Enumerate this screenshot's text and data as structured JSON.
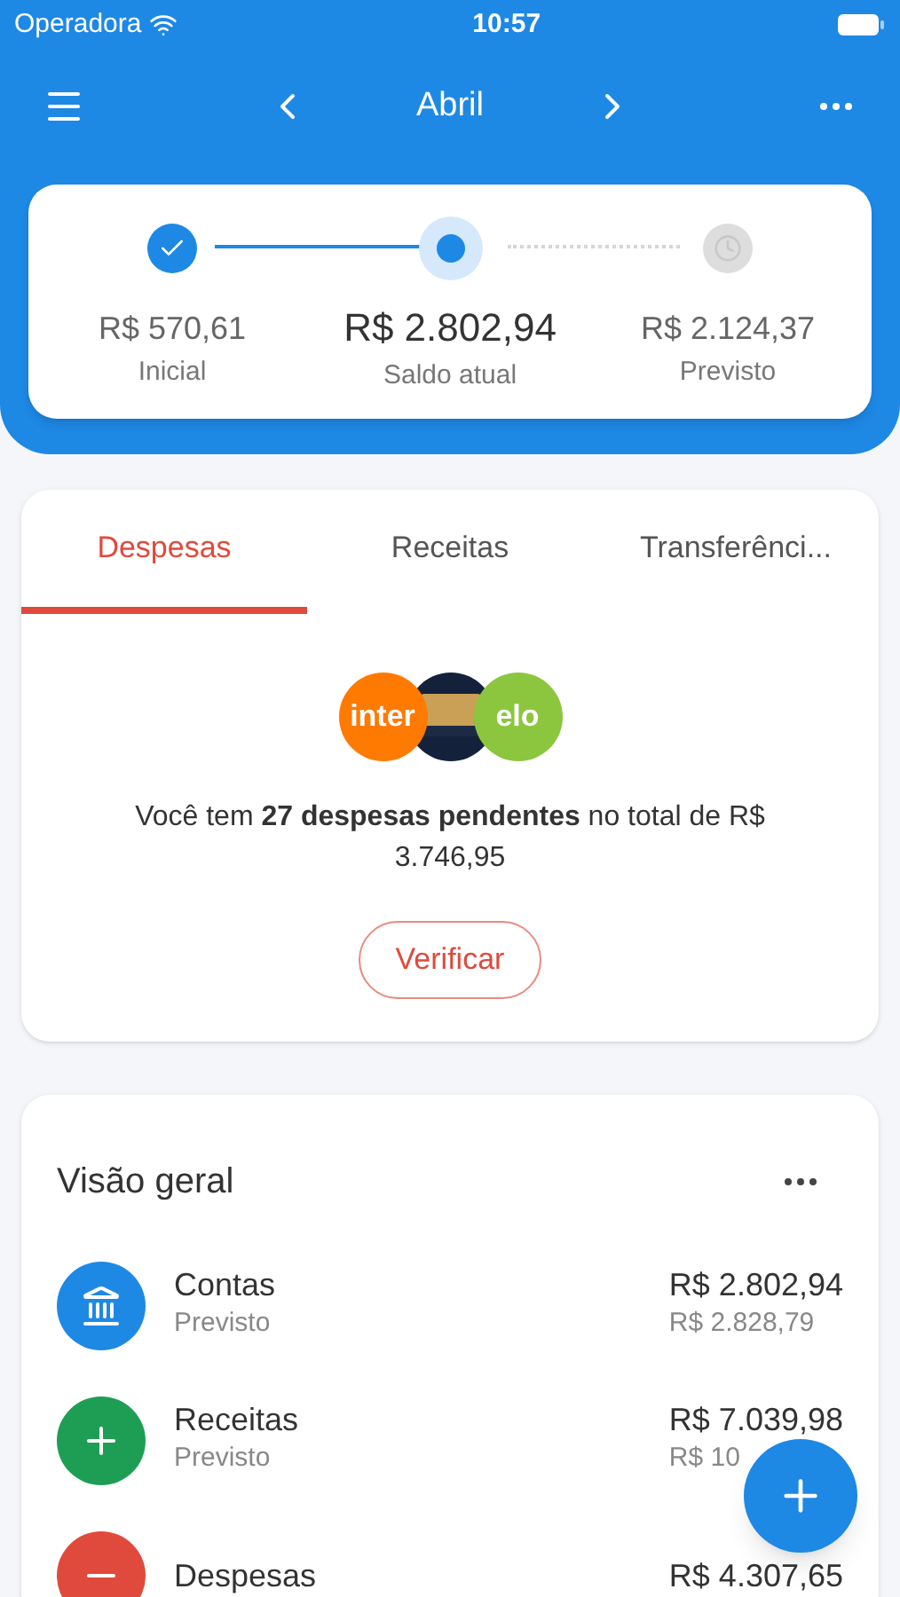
{
  "status_bar": {
    "carrier": "Operadora",
    "time": "10:57"
  },
  "nav": {
    "month": "Abril"
  },
  "balance_steps": [
    {
      "kind": "done",
      "amount": "R$ 570,61",
      "label": "Inicial"
    },
    {
      "kind": "current",
      "amount": "R$ 2.802,94",
      "label": "Saldo atual"
    },
    {
      "kind": "pending",
      "amount": "R$ 2.124,37",
      "label": "Previsto"
    }
  ],
  "tabs": [
    {
      "label": "Despesas",
      "selected": true
    },
    {
      "label": "Receitas",
      "selected": false
    },
    {
      "label": "Transferênci...",
      "selected": false
    }
  ],
  "logos": [
    {
      "kind": "text",
      "label": "inter",
      "color": "#ff7a00"
    },
    {
      "kind": "picture"
    },
    {
      "kind": "text",
      "label": "elo",
      "color": "#8cc63f"
    }
  ],
  "pending_message": "Você tem **27 despesas pendentes** no total de R$ 3.746,95",
  "verify_button": "Verificar",
  "overview": {
    "title": "Visão geral",
    "rows": [
      {
        "kind": "bank",
        "name": "Contas",
        "sub": "Previsto",
        "amount": "R$ 2.802,94",
        "forecast": "R$ 2.828,79",
        "color": "#1e88e5"
      },
      {
        "kind": "plus",
        "name": "Receitas",
        "sub": "Previsto",
        "amount": "R$ 7.039,98",
        "forecast": "R$ 10",
        "color": "#1e9e55"
      },
      {
        "kind": "minus",
        "name": "Despesas",
        "amount": "R$ 4.307,65",
        "color": "#e04a3c"
      }
    ]
  }
}
